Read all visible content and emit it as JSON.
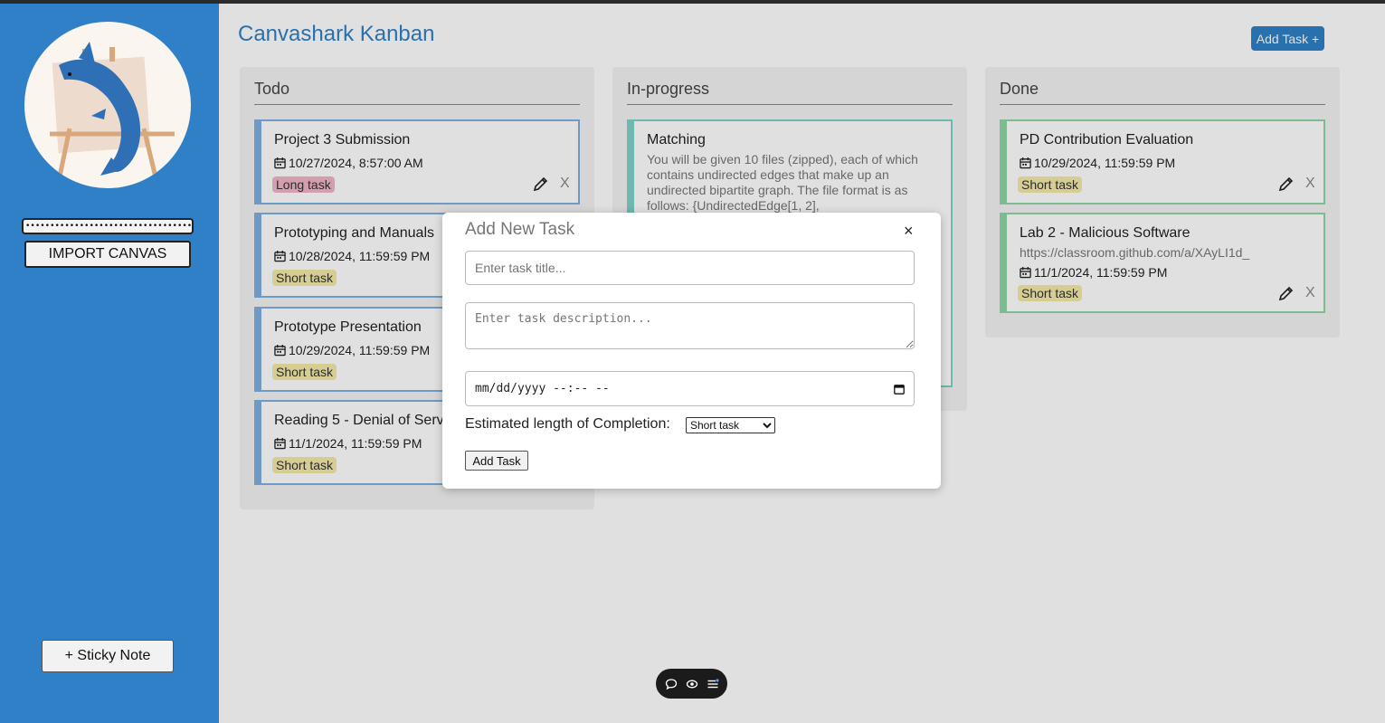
{
  "sidebar": {
    "token_value": "•••••••••••••••••••••••••••••••••••••••••••••••",
    "import_label": "IMPORT CANVAS",
    "sticky_label": "+ Sticky Note"
  },
  "header": {
    "title": "Canvashark Kanban",
    "add_task_label": "Add Task +"
  },
  "columns": [
    {
      "title": "Todo",
      "cards": [
        {
          "title": "Project 3 Submission",
          "date": "10/27/2024, 8:57:00 AM",
          "tag": "Long task"
        },
        {
          "title": "Prototyping and Manuals",
          "date": "10/28/2024, 11:59:59 PM",
          "tag": "Short task"
        },
        {
          "title": "Prototype Presentation",
          "date": "10/29/2024, 11:59:59 PM",
          "tag": "Short task"
        },
        {
          "title": "Reading 5 - Denial of Service",
          "date": "11/1/2024, 11:59:59 PM",
          "tag": "Short task"
        }
      ]
    },
    {
      "title": "In-progress",
      "cards": [
        {
          "title": "Matching",
          "description": "You will be given 10 files (zipped), each of which contains undirected edges that make up an undirected bipartite graph. The file format is as follows: {UndirectedEdge[1, 2],"
        }
      ]
    },
    {
      "title": "Done",
      "cards": [
        {
          "title": "PD Contribution Evaluation",
          "date": "10/29/2024, 11:59:59 PM",
          "tag": "Short task"
        },
        {
          "title": "Lab 2 - Malicious Software",
          "link": "https://classroom.github.com/a/XAyLI1d_",
          "date": "11/1/2024, 11:59:59 PM",
          "tag": "Short task"
        }
      ]
    }
  ],
  "card_actions": {
    "delete_label": "X"
  },
  "modal": {
    "title": "Add New Task",
    "close_label": "×",
    "title_placeholder": "Enter task title...",
    "description_placeholder": "Enter task description...",
    "date_placeholder": "mm/dd/yyyy --:-- --",
    "length_label": "Estimated length of Completion:",
    "length_selected": "Short task",
    "submit_label": "Add Task"
  },
  "icons": [
    "calendar-icon",
    "pencil-icon",
    "chat-icon",
    "eye-icon",
    "list-icon"
  ],
  "colors": {
    "sidebar": "#2f80c6",
    "accent": "#2f80c6",
    "short_tag": "#f4eaa7",
    "long_tag": "#f3b4c6"
  }
}
